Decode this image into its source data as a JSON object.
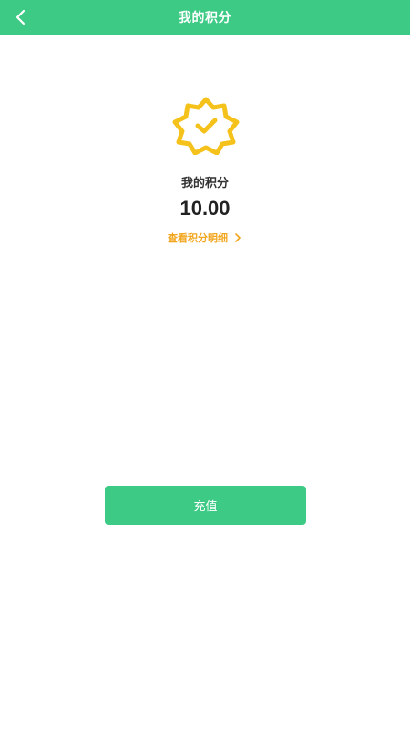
{
  "header": {
    "title": "我的积分",
    "back_icon": "chevron-left-icon"
  },
  "points": {
    "label": "我的积分",
    "value": "10.00",
    "badge_icon": "verified-badge-icon",
    "detail_link": "查看积分明细",
    "detail_icon": "chevron-right-icon"
  },
  "actions": {
    "recharge_label": "充值"
  },
  "colors": {
    "primary": "#3cca85",
    "accent": "#f2a61d",
    "badge": "#f5c21b"
  }
}
